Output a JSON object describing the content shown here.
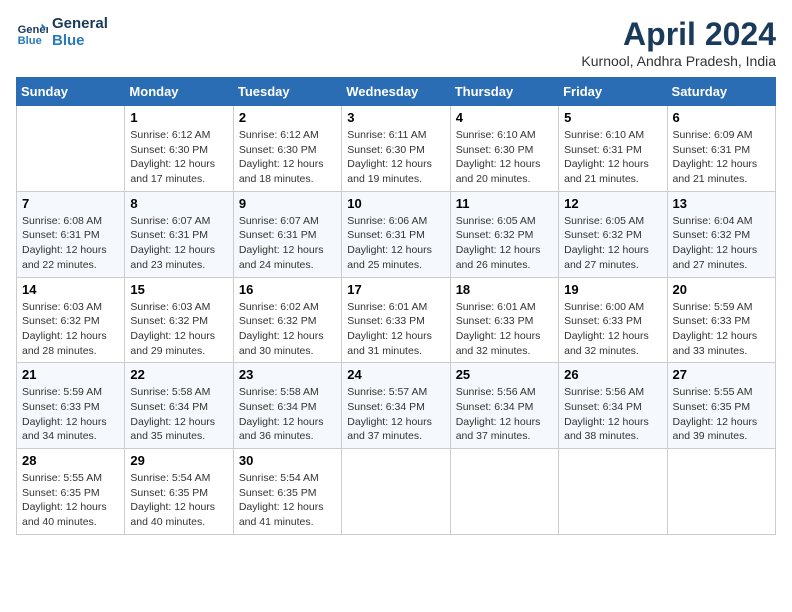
{
  "header": {
    "logo_line1": "General",
    "logo_line2": "Blue",
    "month_title": "April 2024",
    "location": "Kurnool, Andhra Pradesh, India"
  },
  "weekdays": [
    "Sunday",
    "Monday",
    "Tuesday",
    "Wednesday",
    "Thursday",
    "Friday",
    "Saturday"
  ],
  "weeks": [
    [
      {
        "day": "",
        "info": ""
      },
      {
        "day": "1",
        "info": "Sunrise: 6:12 AM\nSunset: 6:30 PM\nDaylight: 12 hours\nand 17 minutes."
      },
      {
        "day": "2",
        "info": "Sunrise: 6:12 AM\nSunset: 6:30 PM\nDaylight: 12 hours\nand 18 minutes."
      },
      {
        "day": "3",
        "info": "Sunrise: 6:11 AM\nSunset: 6:30 PM\nDaylight: 12 hours\nand 19 minutes."
      },
      {
        "day": "4",
        "info": "Sunrise: 6:10 AM\nSunset: 6:30 PM\nDaylight: 12 hours\nand 20 minutes."
      },
      {
        "day": "5",
        "info": "Sunrise: 6:10 AM\nSunset: 6:31 PM\nDaylight: 12 hours\nand 21 minutes."
      },
      {
        "day": "6",
        "info": "Sunrise: 6:09 AM\nSunset: 6:31 PM\nDaylight: 12 hours\nand 21 minutes."
      }
    ],
    [
      {
        "day": "7",
        "info": "Sunrise: 6:08 AM\nSunset: 6:31 PM\nDaylight: 12 hours\nand 22 minutes."
      },
      {
        "day": "8",
        "info": "Sunrise: 6:07 AM\nSunset: 6:31 PM\nDaylight: 12 hours\nand 23 minutes."
      },
      {
        "day": "9",
        "info": "Sunrise: 6:07 AM\nSunset: 6:31 PM\nDaylight: 12 hours\nand 24 minutes."
      },
      {
        "day": "10",
        "info": "Sunrise: 6:06 AM\nSunset: 6:31 PM\nDaylight: 12 hours\nand 25 minutes."
      },
      {
        "day": "11",
        "info": "Sunrise: 6:05 AM\nSunset: 6:32 PM\nDaylight: 12 hours\nand 26 minutes."
      },
      {
        "day": "12",
        "info": "Sunrise: 6:05 AM\nSunset: 6:32 PM\nDaylight: 12 hours\nand 27 minutes."
      },
      {
        "day": "13",
        "info": "Sunrise: 6:04 AM\nSunset: 6:32 PM\nDaylight: 12 hours\nand 27 minutes."
      }
    ],
    [
      {
        "day": "14",
        "info": "Sunrise: 6:03 AM\nSunset: 6:32 PM\nDaylight: 12 hours\nand 28 minutes."
      },
      {
        "day": "15",
        "info": "Sunrise: 6:03 AM\nSunset: 6:32 PM\nDaylight: 12 hours\nand 29 minutes."
      },
      {
        "day": "16",
        "info": "Sunrise: 6:02 AM\nSunset: 6:32 PM\nDaylight: 12 hours\nand 30 minutes."
      },
      {
        "day": "17",
        "info": "Sunrise: 6:01 AM\nSunset: 6:33 PM\nDaylight: 12 hours\nand 31 minutes."
      },
      {
        "day": "18",
        "info": "Sunrise: 6:01 AM\nSunset: 6:33 PM\nDaylight: 12 hours\nand 32 minutes."
      },
      {
        "day": "19",
        "info": "Sunrise: 6:00 AM\nSunset: 6:33 PM\nDaylight: 12 hours\nand 32 minutes."
      },
      {
        "day": "20",
        "info": "Sunrise: 5:59 AM\nSunset: 6:33 PM\nDaylight: 12 hours\nand 33 minutes."
      }
    ],
    [
      {
        "day": "21",
        "info": "Sunrise: 5:59 AM\nSunset: 6:33 PM\nDaylight: 12 hours\nand 34 minutes."
      },
      {
        "day": "22",
        "info": "Sunrise: 5:58 AM\nSunset: 6:34 PM\nDaylight: 12 hours\nand 35 minutes."
      },
      {
        "day": "23",
        "info": "Sunrise: 5:58 AM\nSunset: 6:34 PM\nDaylight: 12 hours\nand 36 minutes."
      },
      {
        "day": "24",
        "info": "Sunrise: 5:57 AM\nSunset: 6:34 PM\nDaylight: 12 hours\nand 37 minutes."
      },
      {
        "day": "25",
        "info": "Sunrise: 5:56 AM\nSunset: 6:34 PM\nDaylight: 12 hours\nand 37 minutes."
      },
      {
        "day": "26",
        "info": "Sunrise: 5:56 AM\nSunset: 6:34 PM\nDaylight: 12 hours\nand 38 minutes."
      },
      {
        "day": "27",
        "info": "Sunrise: 5:55 AM\nSunset: 6:35 PM\nDaylight: 12 hours\nand 39 minutes."
      }
    ],
    [
      {
        "day": "28",
        "info": "Sunrise: 5:55 AM\nSunset: 6:35 PM\nDaylight: 12 hours\nand 40 minutes."
      },
      {
        "day": "29",
        "info": "Sunrise: 5:54 AM\nSunset: 6:35 PM\nDaylight: 12 hours\nand 40 minutes."
      },
      {
        "day": "30",
        "info": "Sunrise: 5:54 AM\nSunset: 6:35 PM\nDaylight: 12 hours\nand 41 minutes."
      },
      {
        "day": "",
        "info": ""
      },
      {
        "day": "",
        "info": ""
      },
      {
        "day": "",
        "info": ""
      },
      {
        "day": "",
        "info": ""
      }
    ]
  ]
}
